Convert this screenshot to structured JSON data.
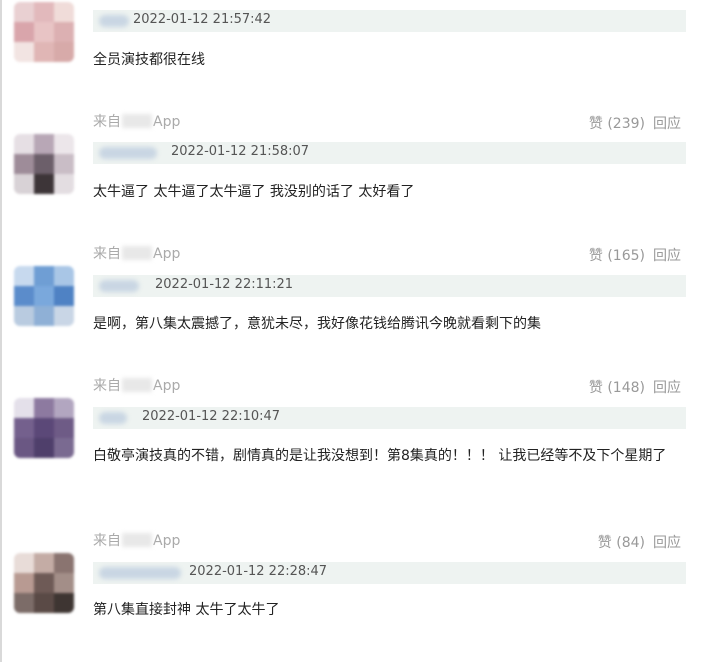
{
  "comments": [
    {
      "timestamp": "2022-01-12 21:57:42",
      "text": "全员演技都很在线",
      "source_prefix": "来自",
      "source_suffix": "App",
      "likes": "赞 (239)",
      "reply": "回应",
      "avatar_colors": [
        "#e9d0d2",
        "#e2b9bc",
        "#f0dcd9",
        "#d9a5ab",
        "#e8c4c5",
        "#dcb0b2",
        "#f2e4e2",
        "#e0b6b5",
        "#d7aaa9"
      ]
    },
    {
      "timestamp": "2022-01-12 21:58:07",
      "text": "太牛逼了 太牛逼了太牛逼了 我没别的话了 太好看了",
      "source_prefix": "来自",
      "source_suffix": "App",
      "likes": "赞 (165)",
      "reply": "回应",
      "avatar_colors": [
        "#e6dfe4",
        "#b8a7b6",
        "#ece6ea",
        "#9e8c99",
        "#6c5f6a",
        "#c9bdc6",
        "#d8d2d6",
        "#3d3538",
        "#e3dde1"
      ]
    },
    {
      "timestamp": "2022-01-12 22:11:21",
      "text": "是啊，第八集太震撼了，意犹未尽，我好像花钱给腾讯今晚就看剩下的集",
      "source_prefix": "来自",
      "source_suffix": "App",
      "likes": "赞 (148)",
      "reply": "回应",
      "avatar_colors": [
        "#c7d9ee",
        "#6f9ed4",
        "#a9c6e6",
        "#5b8ccb",
        "#7aa8dc",
        "#4f82c4",
        "#b9cbe0",
        "#8fb0d6",
        "#c9d6e6"
      ]
    },
    {
      "timestamp": "2022-01-12 22:10:47",
      "text": "白敬亭演技真的不错，剧情真的是让我没想到！第8集真的！！！ 让我已经等不及下个星期了",
      "source_prefix": "来自",
      "source_suffix": "App",
      "likes": "赞 (84)",
      "reply": "回应",
      "avatar_colors": [
        "#e4e0ea",
        "#8d7aa0",
        "#b2a6c0",
        "#74608d",
        "#5b4878",
        "#6e5b86",
        "#6a5783",
        "#4f3f6b",
        "#7a6a91"
      ]
    },
    {
      "timestamp": "2022-01-12 22:28:47",
      "text": "第八集直接封神 太牛了太牛了",
      "source_prefix": "",
      "source_suffix": "",
      "likes": "",
      "reply": "",
      "avatar_colors": [
        "#e8dcd8",
        "#c4aca5",
        "#8a7470",
        "#b89a92",
        "#6e5a56",
        "#a38e88",
        "#7c6c68",
        "#5a4a46",
        "#3e3532"
      ]
    }
  ]
}
